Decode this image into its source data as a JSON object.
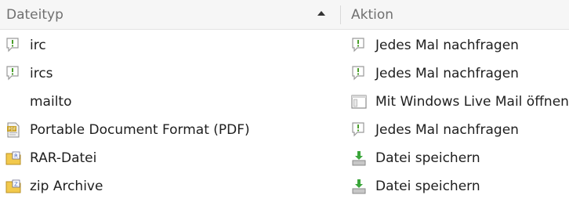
{
  "header": {
    "type_label": "Dateityp",
    "action_label": "Aktion",
    "sort_direction": "ascending"
  },
  "rows": [
    {
      "type": "irc",
      "type_icon": "speech-bubble-icon",
      "action": "Jedes Mal nachfragen",
      "action_icon": "speech-bubble-icon"
    },
    {
      "type": "ircs",
      "type_icon": "speech-bubble-icon",
      "action": "Jedes Mal nachfragen",
      "action_icon": "speech-bubble-icon"
    },
    {
      "type": "mailto",
      "type_icon": "",
      "action": "Mit Windows Live Mail öffnen",
      "action_icon": "application-window-icon"
    },
    {
      "type": "Portable Document Format (PDF)",
      "type_icon": "pdf-document-icon",
      "action": "Jedes Mal nachfragen",
      "action_icon": "speech-bubble-icon"
    },
    {
      "type": "RAR-Datei",
      "type_icon": "rar-archive-icon",
      "action": "Datei speichern",
      "action_icon": "download-save-icon"
    },
    {
      "type": "zip Archive",
      "type_icon": "zip-archive-icon",
      "action": "Datei speichern",
      "action_icon": "download-save-icon"
    }
  ],
  "colors": {
    "header_bg": "#f6f6f6",
    "bubble_green": "#5aa52b",
    "archive_yellow": "#f2c94c",
    "archive_badge": "#3f5fbf"
  }
}
